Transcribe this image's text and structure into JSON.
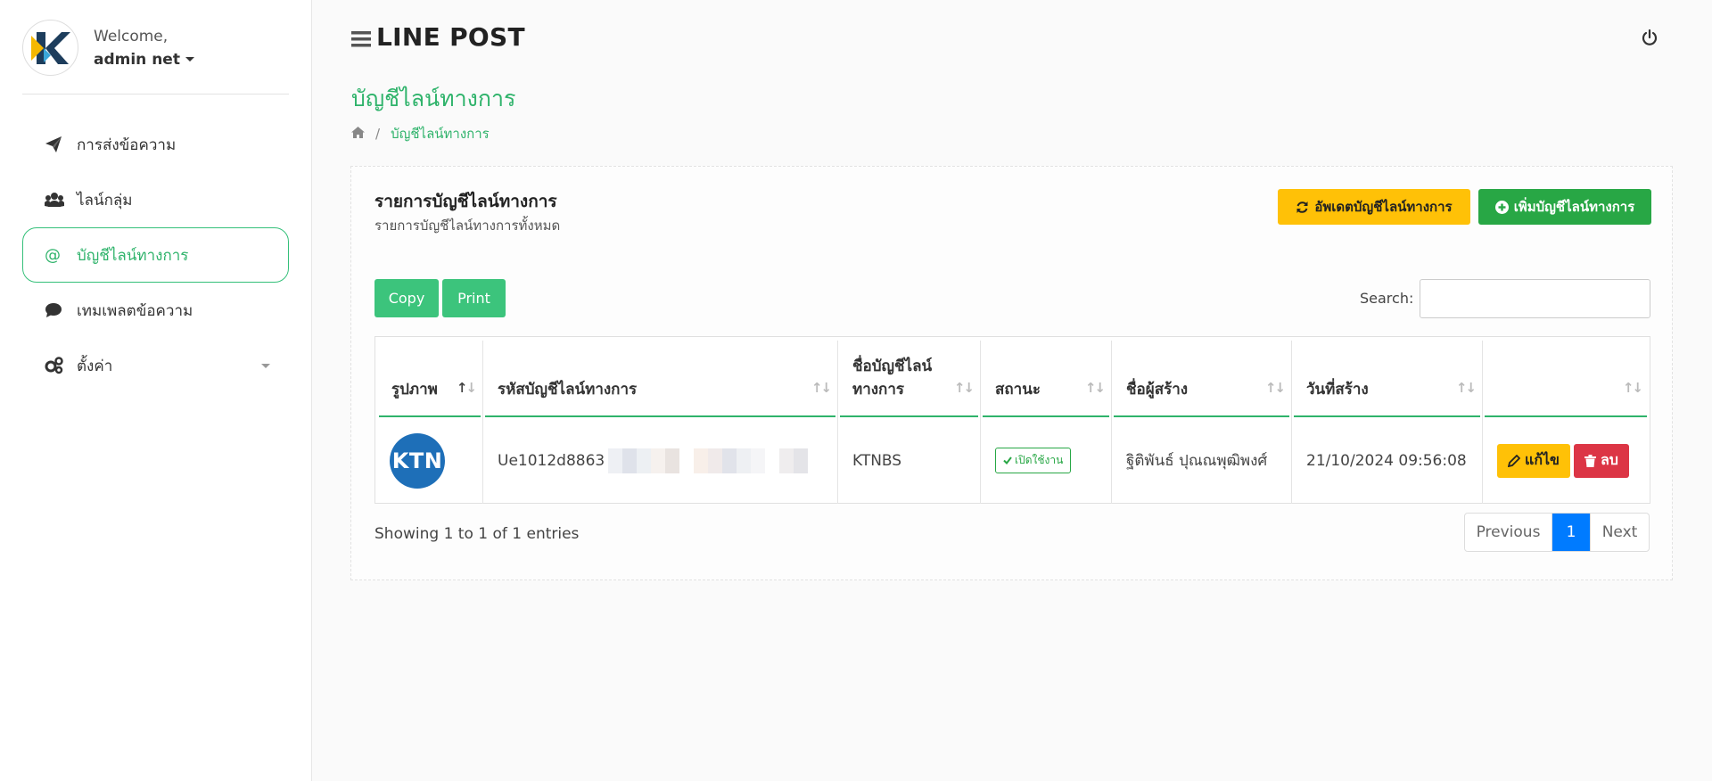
{
  "user": {
    "welcome": "Welcome,",
    "name": "admin net"
  },
  "sidebar": {
    "items": [
      {
        "label": "การส่งข้อความ",
        "icon": "paper-plane-icon"
      },
      {
        "label": "ไลน์กลุ่ม",
        "icon": "users-icon"
      },
      {
        "label": "บัญชีไลน์ทางการ",
        "icon": "at-icon",
        "active": true
      },
      {
        "label": "เทมเพลตข้อความ",
        "icon": "comment-icon"
      },
      {
        "label": "ตั้งค่า",
        "icon": "gears-icon"
      }
    ]
  },
  "header": {
    "brand": "LINE POST"
  },
  "page": {
    "title": "บัญชีไลน์ทางการ",
    "breadcrumb": "บัญชีไลน์ทางการ"
  },
  "card": {
    "title": "รายการบัญชีไลน์ทางการ",
    "subtitle": "รายการบัญชีไลน์ทางการทั้งหมด",
    "update_label": "อัพเดตบัญชีไลน์ทางการ",
    "add_label": "เพิ่มบัญชีไลน์ทางการ"
  },
  "toolbar": {
    "copy_label": "Copy",
    "print_label": "Print",
    "search_label": "Search:",
    "search_value": ""
  },
  "table": {
    "headers": [
      "รูปภาพ",
      "รหัสบัญชีไลน์ทางการ",
      "ชื่อบัญชีไลน์\nทางการ",
      "สถานะ",
      "ชื่อผู้สร้าง",
      "วันที่สร้าง",
      ""
    ],
    "rows": [
      {
        "avatar_text": "KTN",
        "account_id": "Ue1012d8863",
        "name": "KTNBS",
        "status": "เปิดใช้งาน",
        "creator": "ฐิติพันธ์ ปุณณพุฒิพงศ์",
        "created": "21/10/2024 09:56:08",
        "edit_label": "แก้ไข",
        "delete_label": "ลบ"
      }
    ]
  },
  "footer": {
    "showing": "Showing 1 to 1 of 1 entries",
    "prev_label": "Previous",
    "page": "1",
    "next_label": "Next"
  },
  "colors": {
    "accent": "#2fb36b",
    "warning": "#ffc107",
    "success": "#28a745",
    "danger": "#dc3545",
    "primary": "#007bff",
    "brand_blue": "#1e6fb8"
  }
}
